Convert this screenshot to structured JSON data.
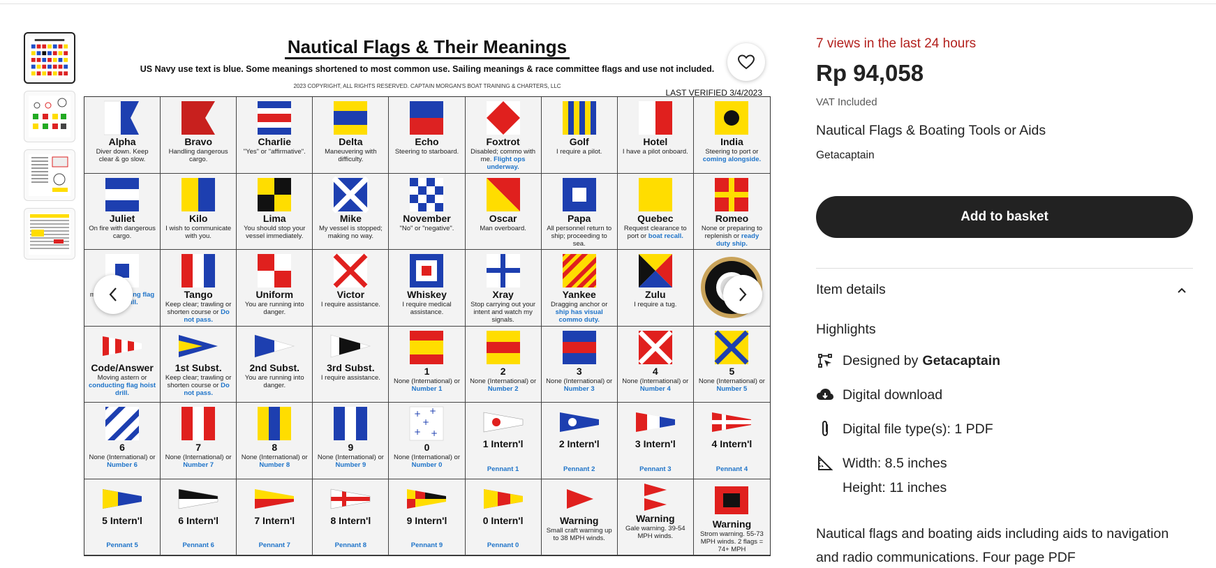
{
  "poster": {
    "title": "Nautical Flags & Their Meanings",
    "subtitle": "US Navy use text is blue. Some meanings shortened to most common use. Sailing meanings & race committee flags and use not included.",
    "copyright": "2023 COPYRIGHT, ALL RIGHTS RESERVED. CAPTAIN MORGAN'S BOAT TRAINING & CHARTERS, LLC",
    "verified": "LAST VERIFIED 3/4/2023",
    "rows": [
      [
        {
          "name": "Alpha",
          "desc": "Diver down. Keep clear & go slow."
        },
        {
          "name": "Bravo",
          "desc": "Handling dangerous cargo."
        },
        {
          "name": "Charlie",
          "desc": "\"Yes\" or \"affirmative\"."
        },
        {
          "name": "Delta",
          "desc": "Maneuvering with difficulty."
        },
        {
          "name": "Echo",
          "desc": "Steering to starboard."
        },
        {
          "name": "Foxtrot",
          "desc": "Disabled; commo with me.",
          "blue": "Flight ops underway."
        },
        {
          "name": "Golf",
          "desc": "I require a pilot."
        },
        {
          "name": "Hotel",
          "desc": "I have a pilot onboard."
        },
        {
          "name": "India",
          "desc": "Steering to port or",
          "blue": "coming alongside."
        }
      ],
      [
        {
          "name": "Juliet",
          "desc": "On fire with dangerous cargo."
        },
        {
          "name": "Kilo",
          "desc": "I wish to communicate with you."
        },
        {
          "name": "Lima",
          "desc": "You should stop your vessel immediately."
        },
        {
          "name": "Mike",
          "desc": "My vessel is stopped; making no way."
        },
        {
          "name": "November",
          "desc": "\"No\" or \"negative\"."
        },
        {
          "name": "Oscar",
          "desc": "Man overboard."
        },
        {
          "name": "Papa",
          "desc": "All personnel return to ship; proceeding to sea."
        },
        {
          "name": "Quebec",
          "desc": "Request clearance to port or",
          "blue": "boat recall."
        },
        {
          "name": "Romeo",
          "desc": "None or preparing to replenish or",
          "blue": "ready duty ship."
        }
      ],
      [
        {
          "name": "",
          "desc": "m or",
          "blue": "conducting flag hoist drill."
        },
        {
          "name": "Tango",
          "desc": "Keep clear; trawling or shorten course or",
          "blue": "Do not pass."
        },
        {
          "name": "Uniform",
          "desc": "You are running into danger."
        },
        {
          "name": "Victor",
          "desc": "I require assistance."
        },
        {
          "name": "Whiskey",
          "desc": "I require medical assistance."
        },
        {
          "name": "Xray",
          "desc": "Stop carrying out your intent and watch my signals."
        },
        {
          "name": "Yankee",
          "desc": "Dragging anchor or",
          "blue": "ship has visual commo duty."
        },
        {
          "name": "Zulu",
          "desc": "I require a tug."
        },
        {
          "name": "",
          "desc": ""
        }
      ],
      [
        {
          "name": "Code/Answer",
          "desc": "Moving astern or",
          "blue": "conducting flag hoist drill."
        },
        {
          "name": "1st Subst.",
          "desc": "Keep clear; trawling or shorten course or",
          "blue": "Do not pass."
        },
        {
          "name": "2nd Subst.",
          "desc": "You are running into danger."
        },
        {
          "name": "3rd Subst.",
          "desc": "I require assistance."
        },
        {
          "name": "1",
          "desc": "None (International) or",
          "blue": "Number 1"
        },
        {
          "name": "2",
          "desc": "None (International) or",
          "blue": "Number 2"
        },
        {
          "name": "3",
          "desc": "None (International) or",
          "blue": "Number 3"
        },
        {
          "name": "4",
          "desc": "None (International) or",
          "blue": "Number 4"
        },
        {
          "name": "5",
          "desc": "None (International) or",
          "blue": "Number 5"
        }
      ],
      [
        {
          "name": "6",
          "desc": "None (International) or",
          "blue": "Number 6"
        },
        {
          "name": "7",
          "desc": "None (International) or",
          "blue": "Number 7"
        },
        {
          "name": "8",
          "desc": "None (International) or",
          "blue": "Number 8"
        },
        {
          "name": "9",
          "desc": "None (International) or",
          "blue": "Number 9"
        },
        {
          "name": "0",
          "desc": "None (International) or",
          "blue": "Number 0"
        },
        {
          "name": "1 Intern'l",
          "blue": "Pennant 1"
        },
        {
          "name": "2 Intern'l",
          "blue": "Pennant 2"
        },
        {
          "name": "3 Intern'l",
          "blue": "Pennant 3"
        },
        {
          "name": "4 Intern'l",
          "blue": "Pennant 4"
        }
      ],
      [
        {
          "name": "5 Intern'l",
          "blue": "Pennant 5"
        },
        {
          "name": "6 Intern'l",
          "blue": "Pennant 6"
        },
        {
          "name": "7 Intern'l",
          "blue": "Pennant 7"
        },
        {
          "name": "8 Intern'l",
          "blue": "Pennant 8"
        },
        {
          "name": "9 Intern'l",
          "blue": "Pennant 9"
        },
        {
          "name": "0 Intern'l",
          "blue": "Pennant 0"
        },
        {
          "name": "Warning",
          "desc": "Small craft warning up to 38 MPH winds."
        },
        {
          "name": "Warning",
          "desc": "Gale warning. 39-54 MPH winds."
        },
        {
          "name": "Warning",
          "desc": "Strom warning. 55-73 MPH winds. 2 flags = 74+ MPH"
        }
      ]
    ]
  },
  "product": {
    "views": "7 views in the last 24 hours",
    "price": "Rp 94,058",
    "vat": "VAT Included",
    "title": "Nautical Flags & Boating Tools or Aids",
    "shop": "Getacaptain",
    "add_to_basket": "Add to basket",
    "item_details": "Item details",
    "highlights_title": "Highlights",
    "highlights": {
      "designed_by_prefix": "Designed by",
      "designed_by": "Getacaptain",
      "digital": "Digital download",
      "filetype": "Digital file type(s): 1 PDF",
      "width": "Width: 8.5 inches",
      "height": "Height: 11 inches"
    },
    "description": "Nautical flags and boating aids including aids to navigation and radio communications. Four page PDF"
  }
}
